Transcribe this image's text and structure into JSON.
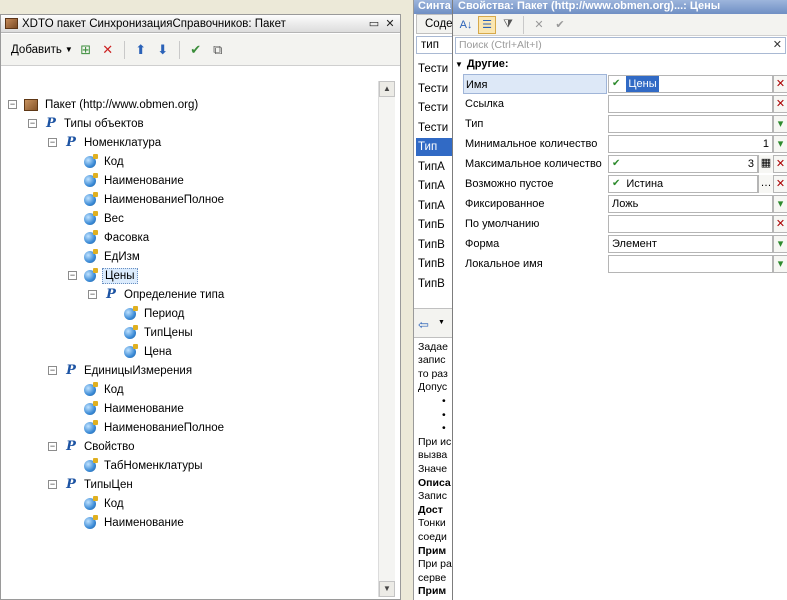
{
  "left_window": {
    "title": "XDTO пакет СинхронизацияСправочников: Пакет",
    "add_label": "Добавить"
  },
  "tree": [
    {
      "label": "Пакет (http://www.obmen.org)",
      "icon": "package-icon",
      "toggle": "−"
    },
    {
      "label": "Типы объектов",
      "icon": "object-type-icon",
      "toggle": "−"
    },
    {
      "label": "Номенклатура",
      "icon": "object-type-icon",
      "toggle": "−"
    },
    {
      "label": "Код",
      "icon": "property-icon"
    },
    {
      "label": "Наименование",
      "icon": "property-icon"
    },
    {
      "label": "НаименованиеПолное",
      "icon": "property-icon"
    },
    {
      "label": "Вес",
      "icon": "property-icon"
    },
    {
      "label": "Фасовка",
      "icon": "property-icon"
    },
    {
      "label": "ЕдИзм",
      "icon": "property-icon"
    },
    {
      "label": "Цены",
      "icon": "property-icon",
      "toggle": "−",
      "selected": true
    },
    {
      "label": "Определение типа",
      "icon": "object-type-icon",
      "toggle": "−"
    },
    {
      "label": "Период",
      "icon": "property-icon"
    },
    {
      "label": "ТипЦены",
      "icon": "property-icon"
    },
    {
      "label": "Цена",
      "icon": "property-icon"
    },
    {
      "label": "ЕдиницыИзмерения",
      "icon": "object-type-icon",
      "toggle": "−"
    },
    {
      "label": "Код",
      "icon": "property-icon"
    },
    {
      "label": "Наименование",
      "icon": "property-icon"
    },
    {
      "label": "НаименованиеПолное",
      "icon": "property-icon"
    },
    {
      "label": "Свойство",
      "icon": "object-type-icon",
      "toggle": "−"
    },
    {
      "label": "ТабНоменклатуры",
      "icon": "property-icon"
    },
    {
      "label": "ТипыЦен",
      "icon": "object-type-icon",
      "toggle": "−"
    },
    {
      "label": "Код",
      "icon": "property-icon"
    },
    {
      "label": "Наименование",
      "icon": "property-icon"
    }
  ],
  "middle_window": {
    "title": "Синта",
    "tab": "Соде",
    "input_value": "тип",
    "rows": [
      "Тести",
      "Тести",
      "Тести",
      "Тести",
      "Тип",
      "ТипА",
      "ТипА",
      "ТипА",
      "ТипБ",
      "ТипВ",
      "ТипВ",
      "ТипВ"
    ],
    "help_lines": [
      "Задае",
      "запис",
      "то раз",
      "Допус",
      "•",
      "•",
      "•",
      "При ис",
      "вызва",
      "Значе",
      "Описа",
      "Запис",
      "Дост",
      "Тонки",
      "соеди",
      "Прим",
      "При ра",
      "серве",
      "Прим"
    ]
  },
  "props_window": {
    "title": "Свойства: Пакет (http://www.obmen.org)...: Цены",
    "search_placeholder": "Поиск (Ctrl+Alt+I)",
    "group": "Другие:",
    "rows": [
      {
        "name": "Имя",
        "value": "Цены",
        "check": true,
        "button": "x",
        "selected": true
      },
      {
        "name": "Ссылка",
        "value": "",
        "button": "x"
      },
      {
        "name": "Тип",
        "value": "",
        "button": "v"
      },
      {
        "name": "Минимальное количество",
        "value": "1",
        "button": "v",
        "align_right": true
      },
      {
        "name": "Максимальное количество",
        "value": "3",
        "check": true,
        "button": "x",
        "align_right": true,
        "extra": "▦"
      },
      {
        "name": "Возможно пустое",
        "value": "Истина",
        "check": true,
        "button": "x",
        "extra": "…"
      },
      {
        "name": "Фиксированное",
        "value": "Ложь",
        "button": "v"
      },
      {
        "name": "По умолчанию",
        "value": "",
        "button": "x"
      },
      {
        "name": "Форма",
        "value": "Элемент",
        "button": "v"
      },
      {
        "name": "Локальное имя",
        "value": "",
        "button": "v"
      }
    ]
  }
}
